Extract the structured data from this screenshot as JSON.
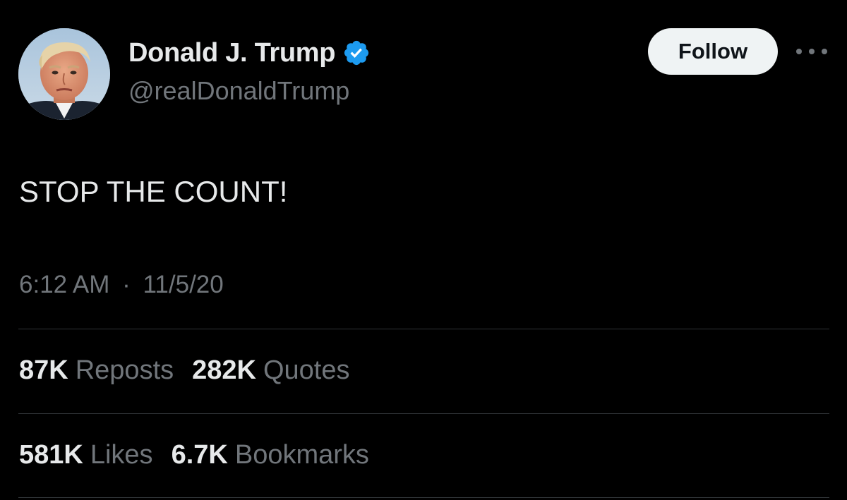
{
  "author": {
    "display_name": "Donald J. Trump",
    "handle": "@realDonaldTrump",
    "verified": true,
    "verified_icon": "verified-badge-icon",
    "verified_color": "#1d9bf0"
  },
  "actions": {
    "follow_label": "Follow",
    "more_icon": "more-options-icon"
  },
  "tweet": {
    "text": "STOP THE COUNT!",
    "time": "6:12 AM",
    "separator": "·",
    "date": "11/5/20"
  },
  "stats": {
    "reposts": {
      "count": "87K",
      "label": "Reposts"
    },
    "quotes": {
      "count": "282K",
      "label": "Quotes"
    },
    "likes": {
      "count": "581K",
      "label": "Likes"
    },
    "bookmarks": {
      "count": "6.7K",
      "label": "Bookmarks"
    }
  },
  "colors": {
    "background": "#000000",
    "primary_text": "#e7e9ea",
    "secondary_text": "#71767b",
    "divider": "#2f3336",
    "follow_bg": "#eff3f4"
  }
}
